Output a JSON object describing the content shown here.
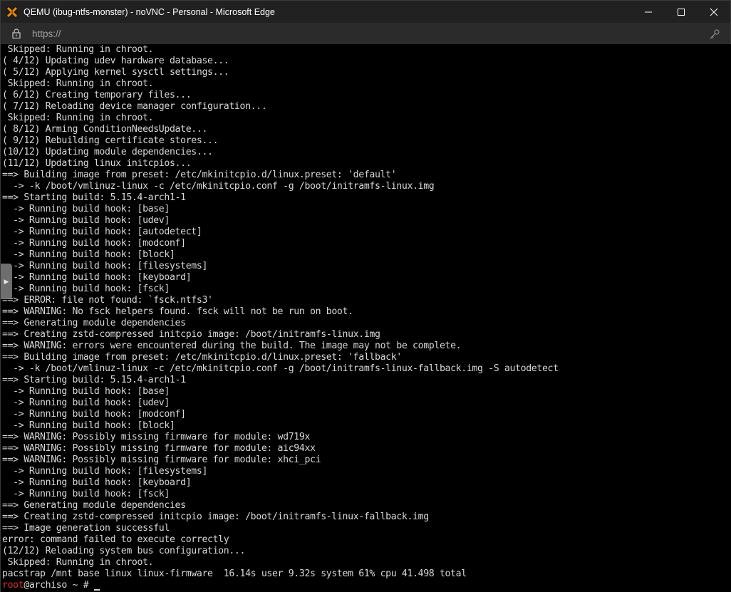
{
  "window": {
    "title": "QEMU (ibug-ntfs-monster) - noVNC - Personal - Microsoft Edge",
    "controls": {
      "minimize": "—",
      "maximize": "☐",
      "close": "✕"
    },
    "colors": {
      "titlebar": "#212121",
      "addressbar": "#2b2b2b",
      "terminal_bg": "#000000",
      "terminal_fg": "#d8d8d8",
      "prompt_user": "#e0302a"
    }
  },
  "addressbar": {
    "url": "https://",
    "lock_icon": "lock-icon",
    "key_icon": "key-icon"
  },
  "sidebar_handle": {
    "glyph": "▶"
  },
  "terminal": {
    "lines": [
      " Skipped: Running in chroot.",
      "( 4/12) Updating udev hardware database...",
      "( 5/12) Applying kernel sysctl settings...",
      " Skipped: Running in chroot.",
      "( 6/12) Creating temporary files...",
      "( 7/12) Reloading device manager configuration...",
      " Skipped: Running in chroot.",
      "( 8/12) Arming ConditionNeedsUpdate...",
      "( 9/12) Rebuilding certificate stores...",
      "(10/12) Updating module dependencies...",
      "(11/12) Updating linux initcpios...",
      "==> Building image from preset: /etc/mkinitcpio.d/linux.preset: 'default'",
      "  -> -k /boot/vmlinuz-linux -c /etc/mkinitcpio.conf -g /boot/initramfs-linux.img",
      "==> Starting build: 5.15.4-arch1-1",
      "  -> Running build hook: [base]",
      "  -> Running build hook: [udev]",
      "  -> Running build hook: [autodetect]",
      "  -> Running build hook: [modconf]",
      "  -> Running build hook: [block]",
      "  -> Running build hook: [filesystems]",
      "  -> Running build hook: [keyboard]",
      "  -> Running build hook: [fsck]",
      "==> ERROR: file not found: `fsck.ntfs3'",
      "==> WARNING: No fsck helpers found. fsck will not be run on boot.",
      "==> Generating module dependencies",
      "==> Creating zstd-compressed initcpio image: /boot/initramfs-linux.img",
      "==> WARNING: errors were encountered during the build. The image may not be complete.",
      "==> Building image from preset: /etc/mkinitcpio.d/linux.preset: 'fallback'",
      "  -> -k /boot/vmlinuz-linux -c /etc/mkinitcpio.conf -g /boot/initramfs-linux-fallback.img -S autodetect",
      "==> Starting build: 5.15.4-arch1-1",
      "  -> Running build hook: [base]",
      "  -> Running build hook: [udev]",
      "  -> Running build hook: [modconf]",
      "  -> Running build hook: [block]",
      "==> WARNING: Possibly missing firmware for module: wd719x",
      "==> WARNING: Possibly missing firmware for module: aic94xx",
      "==> WARNING: Possibly missing firmware for module: xhci_pci",
      "  -> Running build hook: [filesystems]",
      "  -> Running build hook: [keyboard]",
      "  -> Running build hook: [fsck]",
      "==> Generating module dependencies",
      "==> Creating zstd-compressed initcpio image: /boot/initramfs-linux-fallback.img",
      "==> Image generation successful",
      "error: command failed to execute correctly",
      "(12/12) Reloading system bus configuration...",
      " Skipped: Running in chroot.",
      "pacstrap /mnt base linux linux-firmware  16.14s user 9.32s system 61% cpu 41.498 total"
    ],
    "prompt": {
      "user": "root",
      "rest": "@archiso ~ # "
    }
  }
}
